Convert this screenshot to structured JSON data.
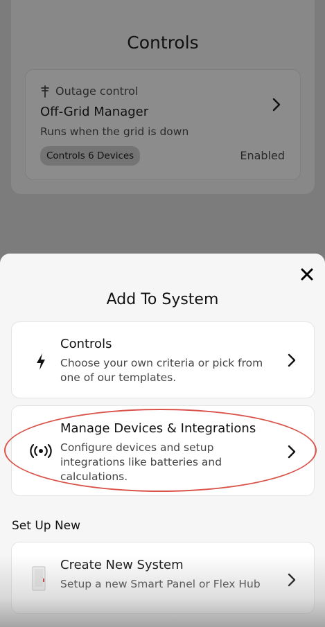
{
  "background": {
    "title": "Controls",
    "rule": {
      "kind": "Outage control",
      "name": "Off-Grid Manager",
      "description": "Runs when the grid is down",
      "badge": "Controls 6 Devices",
      "status": "Enabled"
    }
  },
  "sheet": {
    "title": "Add To System",
    "options": [
      {
        "title": "Controls",
        "description": "Choose your own criteria or pick from one of our templates.",
        "icon": "lightning-bolt-icon"
      },
      {
        "title": "Manage Devices & Integrations",
        "description": "Configure devices and setup integrations like batteries and calculations.",
        "icon": "broadcast-signal-icon"
      }
    ],
    "section_label": "Set Up New",
    "new_options": [
      {
        "title": "Create New System",
        "description": "Setup a new Smart Panel or Flex Hub",
        "icon": "smart-panel-device-icon"
      }
    ]
  },
  "colors": {
    "overlay": "#7c7c7c",
    "sheet": "#f6f6f6",
    "card": "#ffffff",
    "annotation_ring": "#d9534a"
  }
}
